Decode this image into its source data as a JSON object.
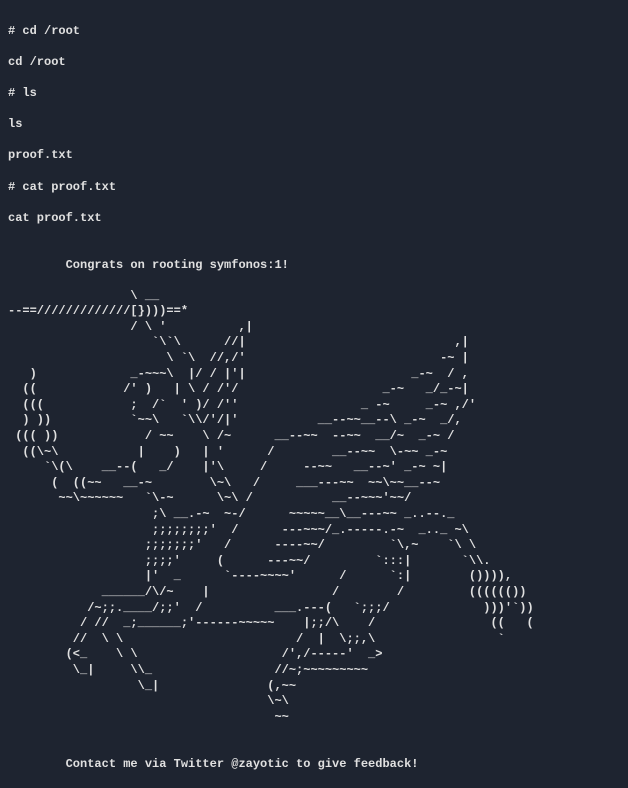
{
  "terminal": {
    "lines": [
      "# cd /root",
      "cd /root",
      "# ls",
      "ls",
      "proof.txt",
      "# cat proof.txt",
      "cat proof.txt"
    ]
  },
  "congrats": "\n        Congrats on rooting symfonos:1!\n",
  "ascii_art": "                 \\ __\n--==/////////////[})))==*\n                 / \\ '          ,|\n                    `\\`\\      //|                             ,|\n                      \\ `\\  //,/'                           -~ |\n   )             _-~~~\\  |/ / |'|                       _-~  / ,\n  ((            /' )   | \\ / /'/                    _-~   _/_-~|\n  (((            ;  /`  ' )/ /''                 _ -~     _-~ ,/'\n  ) ))           `~~\\   `\\\\/'/|'           __--~~__--\\ _-~  _/,\n ((( ))            / ~~    \\ /~      __--~~  --~~  __/~  _-~ /\n  ((\\~\\           |    )   | '      /        __--~~  \\-~~ _-~\n     `\\(\\    __--(   _/    |'\\     /     --~~   __--~' _-~ ~|\n      (  ((~~   __-~        \\~\\   /     ___---~~  ~~\\~~__--~\n       ~~\\~~~~~~   `\\-~      \\~\\ /           __--~~~'~~/\n                    ;\\ __.-~  ~-/      ~~~~~__\\__---~~ _..--._\n                    ;;;;;;;;'  /      ---~~~/_.-----.-~  _.._ ~\\\n                   ;;;;;;;'   /      ----~~/         `\\,~    `\\ \\\n                   ;;;;'     (      ---~~/         `:::|       `\\\\.\n                   |'  _      `----~~~~'      /      `:|        ()))),\n             ______/\\/~    |                 /        /         (((((())\n           /~;;.____/;;'  /          ___.---(   `;;;/             )))'`))\n          / //  _;______;'------~~~~~    |;;/\\    /                ((   (\n         //  \\ \\                        /  |  \\;;,\\                 `\n        (<_    \\ \\                    /',/-----'  _>\n         \\_|     \\\\_                 //~;~~~~~~~~~\n                  \\_|               (,~~\n                                    \\~\\\n                                     ~~",
  "footer": "\n        Contact me via Twitter @zayotic to give feedback!"
}
